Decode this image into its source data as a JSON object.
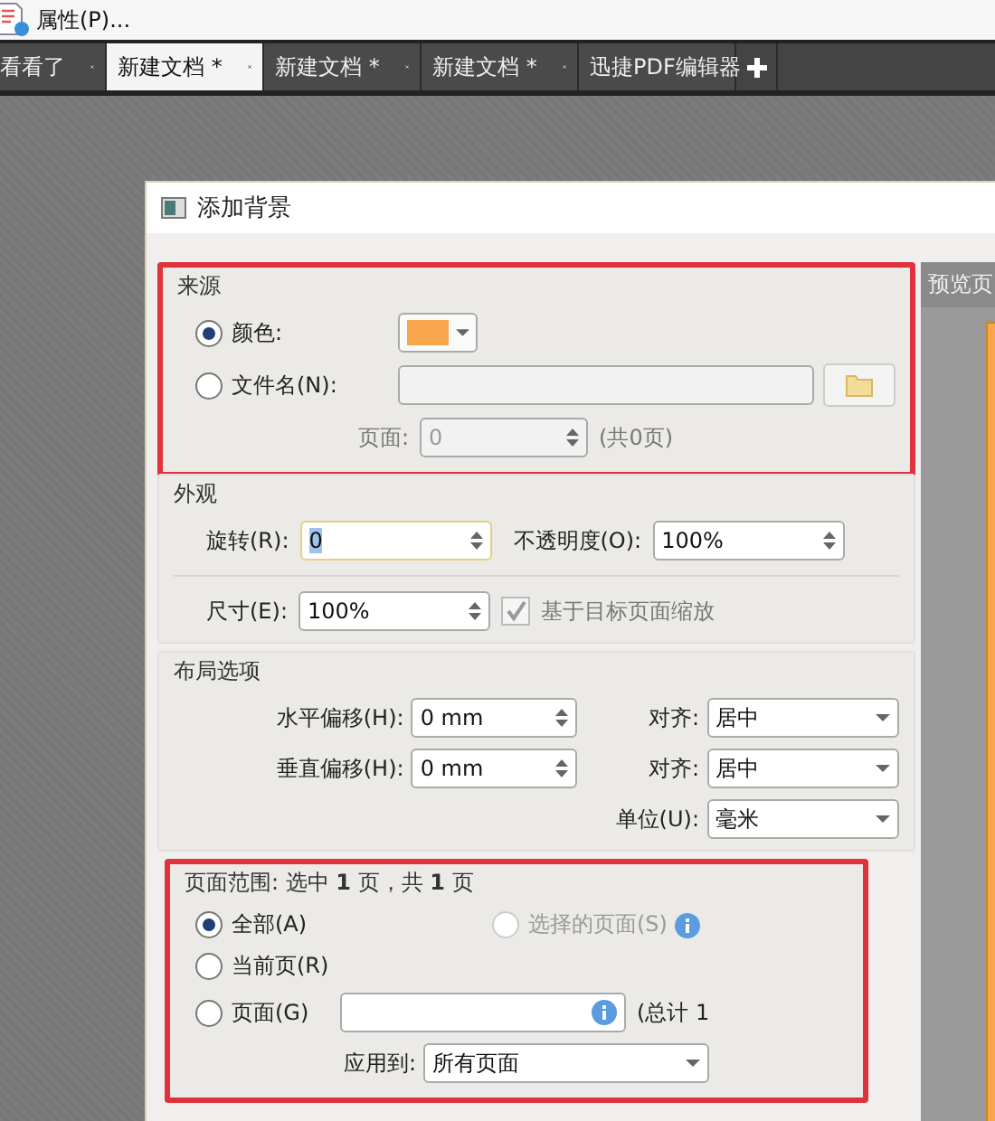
{
  "menu": {
    "items": [
      {
        "label": "属性(P)..."
      }
    ]
  },
  "tabs": [
    {
      "label": "看看了",
      "selected": false
    },
    {
      "label": "新建文档 *",
      "selected": true
    },
    {
      "label": "新建文档 *",
      "selected": false
    },
    {
      "label": "新建文档 *",
      "selected": false
    },
    {
      "label": "迅捷PDF编辑器",
      "selected": false
    }
  ],
  "dialog": {
    "title": "添加背景",
    "source": {
      "title": "来源",
      "highlighted": true,
      "color_label": "颜色:",
      "color_selected": true,
      "color": "#f8a64c",
      "file_label": "文件名(N):",
      "file_selected": false,
      "page_label": "页面:",
      "page_value": "0",
      "page_total": "(共0页)"
    },
    "appearance": {
      "title": "外观",
      "rotation_label": "旋转(R):",
      "rotation": "0",
      "opacity_label": "不透明度(O):",
      "opacity": "100%",
      "size_label": "尺寸(E):",
      "size": "100%",
      "scale_label": "基于目标页面缩放",
      "scale_checked": true
    },
    "layout": {
      "title": "布局选项",
      "rows": [
        {
          "offset_label": "水平偏移(H):",
          "offset": "0 mm",
          "align_label": "对齐:",
          "align": "居中"
        },
        {
          "offset_label": "垂直偏移(H):",
          "offset": "0 mm",
          "align_label": "对齐:",
          "align": "居中"
        }
      ],
      "unit_label": "单位(U):",
      "unit": "毫米"
    },
    "page_range": {
      "title": "页面范围: 选中 **1** 页，共 **1** 页",
      "highlighted": true,
      "options": [
        {
          "label": "全部(A)",
          "selected": true,
          "disabled": false
        },
        {
          "label": "选择的页面(S)",
          "selected": false,
          "disabled": true
        },
        {
          "label": "当前页(R)",
          "selected": false,
          "disabled": false
        },
        {
          "label": "页面(G)",
          "selected": false,
          "disabled": false
        }
      ],
      "total": "(总计 1",
      "apply_label": "应用到:",
      "apply_value": "所有页面"
    },
    "preview": {
      "title": "预览页"
    }
  }
}
